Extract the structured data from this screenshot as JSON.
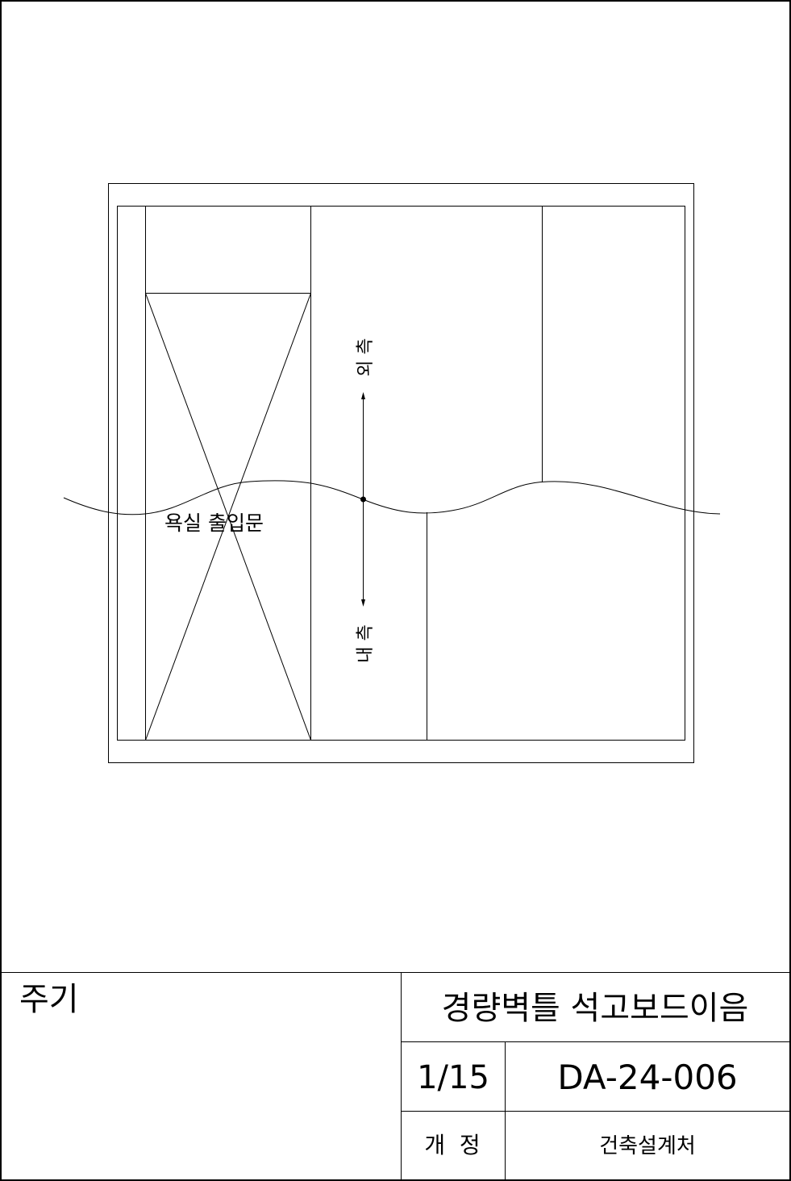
{
  "drawing": {
    "door_label": "욕실 출입문",
    "outer_side_label": "외 측",
    "inner_side_label": "내 측"
  },
  "title_block": {
    "notes_label": "주기",
    "title": "경량벽틀 석고보드이음",
    "sheet": "1/15",
    "drawing_number": "DA-24-006",
    "revision_label": "개  정",
    "department": "건축설계처"
  }
}
